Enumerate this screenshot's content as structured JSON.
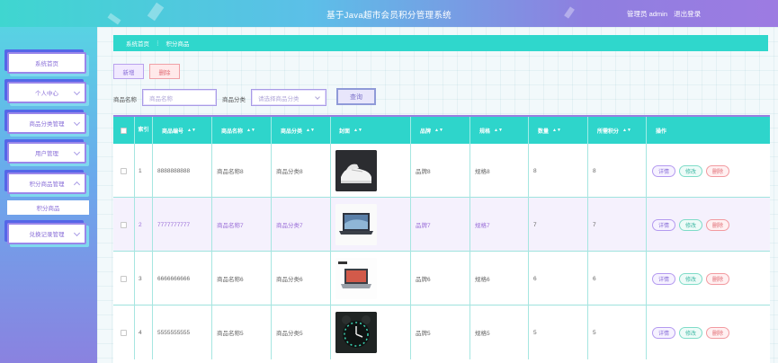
{
  "header": {
    "title": "基于Java超市会员积分管理系统",
    "user_label": "管理员 admin",
    "logout_label": "退出登录"
  },
  "sidebar": {
    "items": [
      {
        "label": "系统首页",
        "has_chevron": false
      },
      {
        "label": "个人中心",
        "has_chevron": true
      },
      {
        "label": "商品分类管理",
        "has_chevron": true
      },
      {
        "label": "用户管理",
        "has_chevron": true
      },
      {
        "label": "积分商品管理",
        "has_chevron": true,
        "expanded": true
      },
      {
        "label": "兑换记录管理",
        "has_chevron": true
      }
    ],
    "submenu_label": "积分商品"
  },
  "breadcrumb": {
    "home": "系统首页",
    "separator": "⋮",
    "current": "积分商品"
  },
  "toolbar": {
    "add_label": "新增",
    "delete_label": "删除"
  },
  "search": {
    "name_label": "商品名称",
    "name_placeholder": "商品名称",
    "category_label": "商品分类",
    "category_placeholder": "请选择商品分类",
    "search_label": "查询"
  },
  "table": {
    "columns": [
      "索引",
      "商品编号",
      "商品名称",
      "商品分类",
      "封面",
      "品牌",
      "规格",
      "数量",
      "所需积分",
      "操作"
    ],
    "sort_glyph": "▲▼",
    "rows": [
      {
        "index": "1",
        "code": "8888888888",
        "name": "商品名称8",
        "category": "商品分类8",
        "cover": "shoe-image",
        "brand": "品牌8",
        "spec": "规格8",
        "qty": "8",
        "points": "8"
      },
      {
        "index": "2",
        "code": "7777777777",
        "name": "商品名称7",
        "category": "商品分类7",
        "cover": "laptop-image",
        "brand": "品牌7",
        "spec": "规格7",
        "qty": "7",
        "points": "7"
      },
      {
        "index": "3",
        "code": "6666666666",
        "name": "商品名称6",
        "category": "商品分类6",
        "cover": "laptop-image",
        "brand": "品牌6",
        "spec": "规格6",
        "qty": "6",
        "points": "6"
      },
      {
        "index": "4",
        "code": "5555555555",
        "name": "商品名称5",
        "category": "商品分类5",
        "cover": "clock-image",
        "brand": "品牌5",
        "spec": "规格5",
        "qty": "5",
        "points": "5"
      }
    ],
    "actions": {
      "detail": "详情",
      "edit": "修改",
      "delete": "删除"
    }
  },
  "colors": {
    "accent_teal": "#2ed5cb",
    "accent_purple": "#9a86ea",
    "danger": "#e06a72"
  }
}
